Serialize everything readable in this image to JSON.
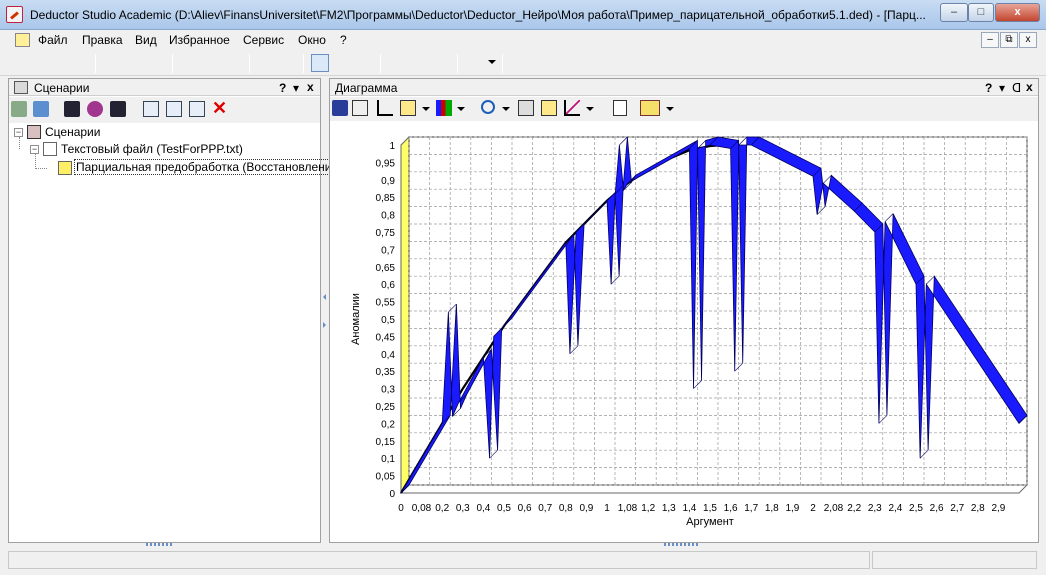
{
  "window": {
    "title": "Deductor Studio Academic (D:\\Aliev\\FinansUniversitet\\FM2\\Программы\\Deductor\\Deductor_Нейро\\Моя работа\\Пример_парицательной_обработки5.1.ded) - [Парц...",
    "minimize": "–",
    "maximize": "□",
    "close": "x"
  },
  "menu": {
    "items": [
      "Файл",
      "Правка",
      "Вид",
      "Избранное",
      "Сервис",
      "Окно",
      "?"
    ],
    "mdi": [
      "–",
      "⧉",
      "x"
    ]
  },
  "left_panel": {
    "title": "Сценарии",
    "controls": [
      "?",
      "▾",
      "x"
    ]
  },
  "tree": {
    "root": "Сценарии",
    "file": "Текстовый файл (TestForPPP.txt)",
    "child": "Парциальная предобработка (Восстановление)"
  },
  "right_panel": {
    "title": "Диаграмма",
    "controls": [
      "?",
      "▾",
      "ᗡ",
      "x"
    ]
  },
  "chart_data": {
    "type": "line",
    "title": "",
    "xlabel": "Аргумент",
    "ylabel": "Аномалии",
    "ylim": [
      0,
      1
    ],
    "yticks": [
      "0",
      "0,05",
      "0,1",
      "0,15",
      "0,2",
      "0,25",
      "0,3",
      "0,35",
      "0,4",
      "0,45",
      "0,5",
      "0,55",
      "0,6",
      "0,65",
      "0,7",
      "0,75",
      "0,8",
      "0,85",
      "0,9",
      "0,95",
      "1"
    ],
    "xticks": [
      "0",
      "0,08",
      "0,2",
      "0,3",
      "0,4",
      "0,5",
      "0,6",
      "0,7",
      "0,8",
      "0,9",
      "1",
      "1,08",
      "1,2",
      "1,3",
      "1,4",
      "1,5",
      "1,6",
      "1,7",
      "1,8",
      "1,9",
      "2",
      "2,08",
      "2,2",
      "2,3",
      "2,4",
      "2,5",
      "2,6",
      "2,7",
      "2,8",
      "2,9"
    ],
    "grid": true,
    "series": [
      {
        "color": "#000000",
        "x": [
          0,
          0.1,
          0.2,
          0.3,
          0.4,
          0.5,
          0.6,
          0.7,
          0.8,
          0.9,
          1,
          1.1,
          1.2,
          1.3,
          1.4,
          1.5,
          1.57
        ],
        "y": [
          0,
          0.1,
          0.2,
          0.3,
          0.39,
          0.48,
          0.56,
          0.64,
          0.72,
          0.78,
          0.84,
          0.89,
          0.93,
          0.96,
          0.985,
          0.997,
          1
        ]
      },
      {
        "color": "#1a1aff",
        "x": [
          0,
          0.2,
          0.23,
          0.25,
          0.28,
          0.4,
          0.43,
          0.45,
          0.5,
          0.8,
          0.82,
          0.85,
          1,
          1.02,
          1.04,
          1.06,
          1.08,
          1.1,
          1.4,
          1.42,
          1.44,
          1.5,
          1.6,
          1.62,
          1.64,
          1.7,
          2,
          2.02,
          2.05,
          2.2,
          2.3,
          2.32,
          2.35,
          2.5,
          2.52,
          2.55,
          3
        ],
        "y": [
          0,
          0.2,
          0.52,
          0.22,
          0.26,
          0.39,
          0.1,
          0.45,
          0.48,
          0.72,
          0.4,
          0.75,
          0.84,
          0.6,
          0.86,
          1.0,
          0.87,
          0.89,
          0.99,
          0.3,
          0.99,
          1.0,
          0.99,
          0.35,
          1.0,
          1.0,
          0.91,
          0.8,
          0.89,
          0.81,
          0.75,
          0.2,
          0.78,
          0.6,
          0.1,
          0.6,
          0.2
        ]
      }
    ]
  },
  "colors": {
    "series_fill": "#1a1aff",
    "wall": "#ffff66",
    "grid": "#9a9a9a"
  },
  "icons": {
    "tree_root": "scenarios-icon",
    "tree_file": "text-file-icon",
    "tree_child": "partial-preprocessing-icon"
  }
}
